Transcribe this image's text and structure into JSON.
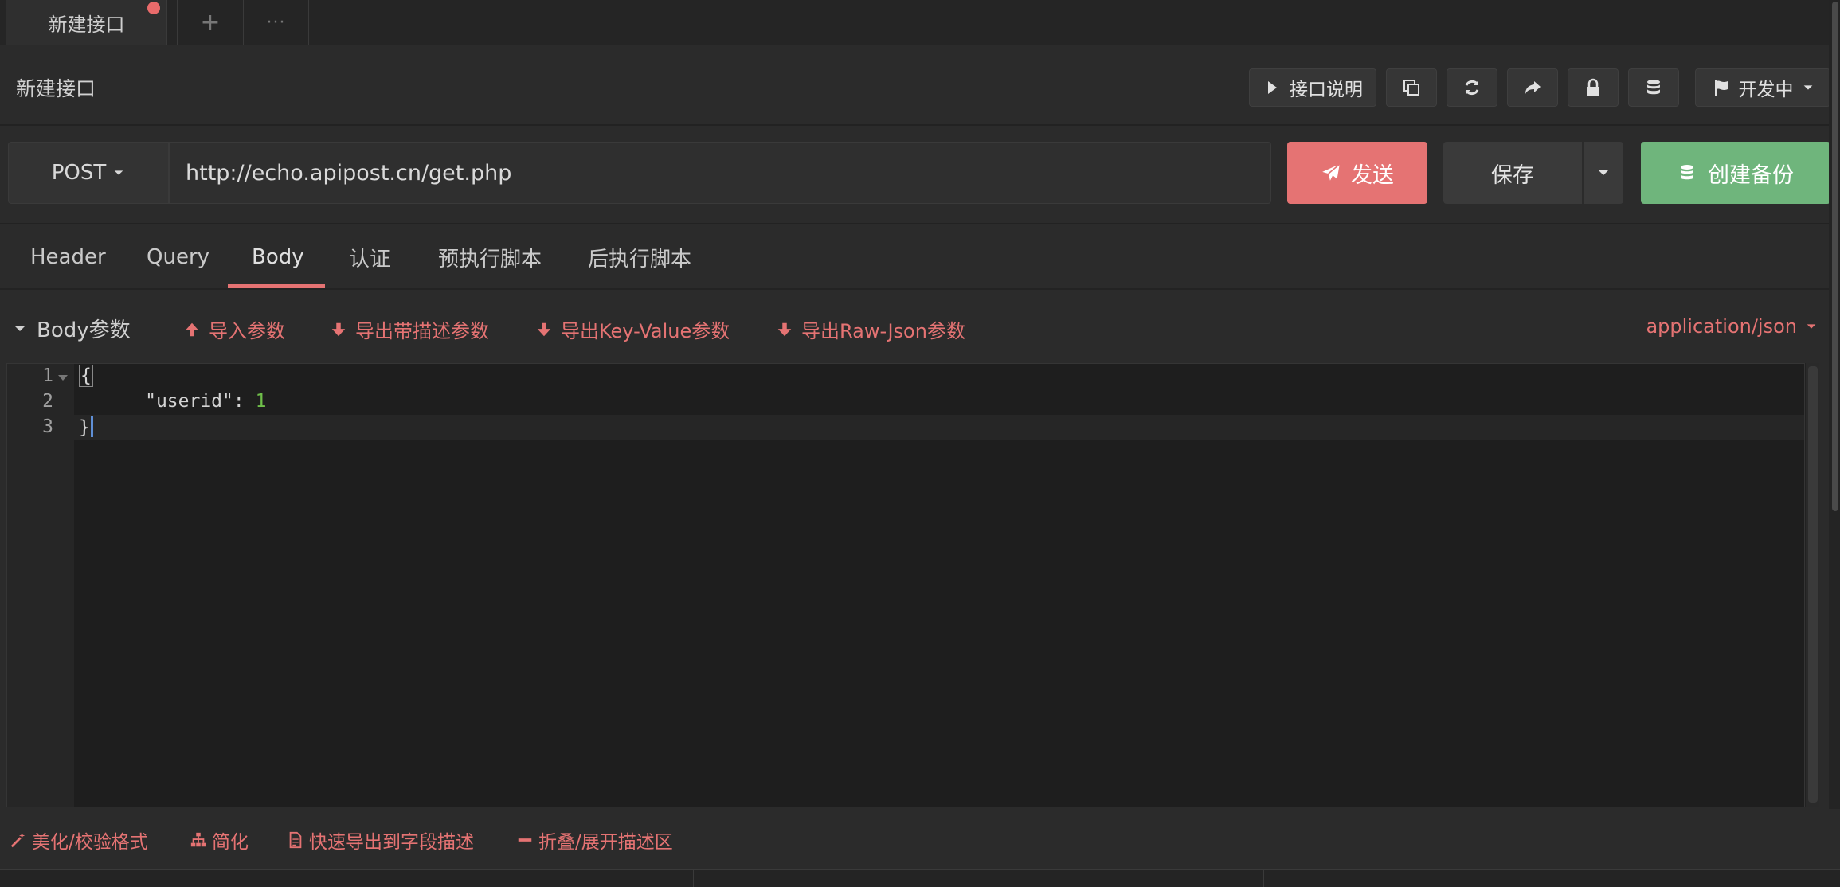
{
  "tabs": {
    "active_label": "新建接口",
    "add_symbol": "+",
    "more_symbol": "···"
  },
  "header": {
    "title": "新建接口",
    "doc_button": "接口说明",
    "status_dropdown": "开发中"
  },
  "request": {
    "method": "POST",
    "url": "http://echo.apipost.cn/get.php",
    "send_label": "发送",
    "save_label": "保存",
    "backup_label": "创建备份"
  },
  "req_tabs": [
    "Header",
    "Query",
    "Body",
    "认证",
    "预执行脚本",
    "后执行脚本"
  ],
  "active_req_tab": "Body",
  "body": {
    "section_label": "Body参数",
    "import_label": "导入参数",
    "export_desc_label": "导出带描述参数",
    "export_kv_label": "导出Key-Value参数",
    "export_raw_label": "导出Raw-Json参数",
    "content_type": "application/json"
  },
  "editor": {
    "line_numbers": [
      "1",
      "2",
      "3"
    ],
    "line1": "{",
    "line2_key": "\"userid\"",
    "line2_colon": ": ",
    "line2_value": "1",
    "line3": "}"
  },
  "bottom": {
    "beautify_label": "美化/校验格式",
    "simplify_label": "简化",
    "export_fields_label": "快速导出到字段描述",
    "toggle_desc_label": "折叠/展开描述区"
  },
  "colors": {
    "accent_red": "#e57373",
    "accent_green": "#6fb57c",
    "number_green": "#6fbf4a"
  }
}
